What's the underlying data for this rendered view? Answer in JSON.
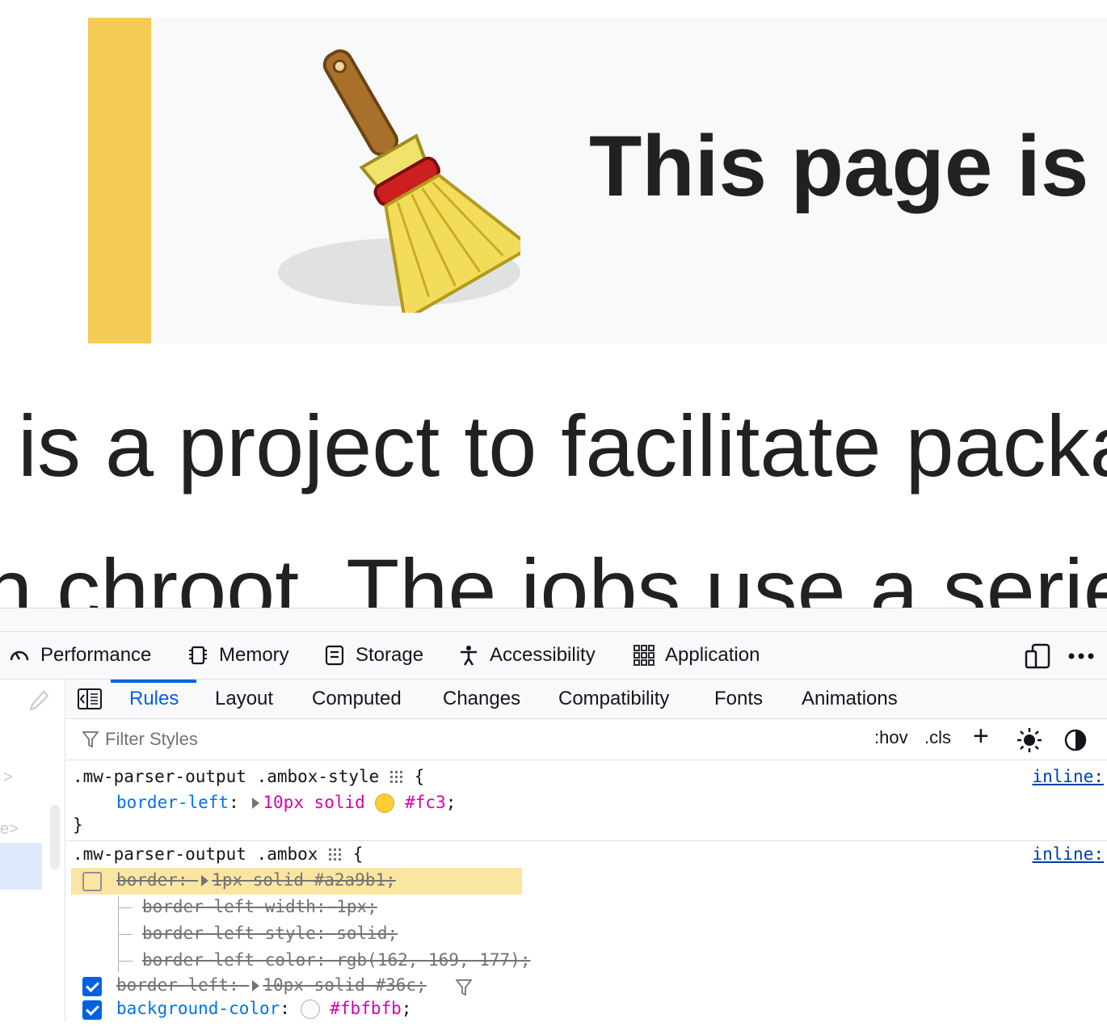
{
  "page": {
    "ambox_title": "This page is",
    "body_line_1": "is a project to facilitate packa",
    "body_line_2": "n chroot. The jobs use a serie"
  },
  "devtools": {
    "tools": [
      {
        "label": "Performance",
        "icon": "performance-gauge-icon"
      },
      {
        "label": "Memory",
        "icon": "memory-chip-icon"
      },
      {
        "label": "Storage",
        "icon": "storage-icon"
      },
      {
        "label": "Accessibility",
        "icon": "accessibility-person-icon"
      },
      {
        "label": "Application",
        "icon": "application-grid-icon"
      }
    ],
    "sub_tabs": [
      "Rules",
      "Layout",
      "Computed",
      "Changes",
      "Compatibility",
      "Fonts",
      "Animations"
    ],
    "active_sub_tab": "Rules",
    "filter": {
      "placeholder": "Filter Styles",
      "hov": ":hov",
      "cls": ".cls",
      "add": "+"
    },
    "rules": [
      {
        "selector": ".mw-parser-output .ambox-style",
        "open_brace": "{",
        "close_brace": "}",
        "source": "inline:",
        "declarations": [
          {
            "property": "border-left",
            "colon": ":",
            "value": "10px solid",
            "color_value": "#fc3",
            "swatch": "#ffcc33",
            "semicolon": ";"
          }
        ]
      },
      {
        "selector": ".mw-parser-output .ambox",
        "open_brace": "{",
        "source": "inline:",
        "declarations": [
          {
            "property": "border",
            "colon": ":",
            "value": "1px solid #a2a9b1",
            "semicolon": ";",
            "overridden": true,
            "checked": false
          },
          {
            "property": "border-left-width",
            "colon": ":",
            "value": "1px",
            "semicolon": ";",
            "sub": true
          },
          {
            "property": "border-left-style",
            "colon": ":",
            "value": "solid",
            "semicolon": ";",
            "sub": true
          },
          {
            "property": "border-left-color",
            "colon": ":",
            "value": "rgb(162, 169, 177)",
            "semicolon": ";",
            "sub": true
          },
          {
            "property": "border-left",
            "colon": ":",
            "value": "10px solid #36c",
            "semicolon": ";",
            "overridden": true,
            "checked": true
          },
          {
            "property": "background-color",
            "colon": ":",
            "value": "#fbfbfb",
            "swatch": "#fbfbfb",
            "semicolon": ";",
            "checked": true
          }
        ]
      }
    ],
    "colors": {
      "accent": "#0061e0",
      "property": "#0074e8",
      "value": "#dd00a9",
      "highlight": "#fbe6a1",
      "ambox_border": "#f5cc55"
    }
  }
}
